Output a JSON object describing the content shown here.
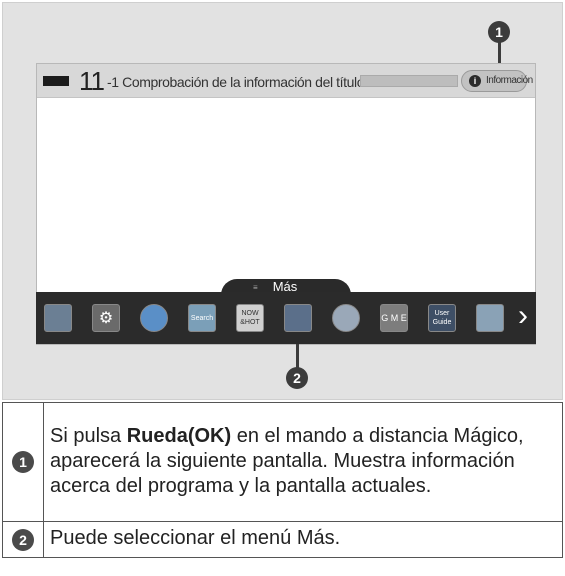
{
  "screen": {
    "channel_number": "11",
    "program_title": "-1 Comprobación de la información del título...",
    "info_button_label": "Información",
    "more_menu_label": "Más"
  },
  "callouts": [
    "1",
    "2"
  ],
  "menu_apps": [
    {
      "name": "input-app",
      "color": "#6b7f94",
      "label": ""
    },
    {
      "name": "settings-app",
      "color": "#6a6a6a",
      "label": "⚙"
    },
    {
      "name": "internet-app",
      "color": "#5a8fc7",
      "label": ""
    },
    {
      "name": "search-app",
      "color": "#7b9fb8",
      "label": "Search"
    },
    {
      "name": "now-hot-app",
      "color": "#d0d0d0",
      "label": "NOW &HOT"
    },
    {
      "name": "smart-share-app",
      "color": "#5b6f8a",
      "label": ""
    },
    {
      "name": "clock-app",
      "color": "#9aa8b8",
      "label": ""
    },
    {
      "name": "game-app",
      "color": "#7d7d7d",
      "label": "G M E"
    },
    {
      "name": "user-guide-app",
      "color": "#3e4f66",
      "label": "User Guide"
    },
    {
      "name": "photo-app",
      "color": "#8aa2b6",
      "label": ""
    }
  ],
  "steps": [
    {
      "num": "1",
      "before": "Si pulsa ",
      "bold": "Rueda(OK)",
      "after": " en el mando a distancia Mágico, aparecerá la siguiente pantalla. Muestra información acerca del programa y la pantalla actuales."
    },
    {
      "num": "2",
      "before": "Puede seleccionar el menú Más.",
      "bold": "",
      "after": ""
    }
  ]
}
